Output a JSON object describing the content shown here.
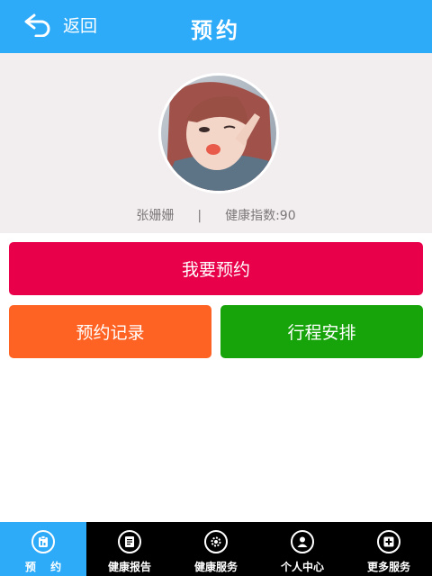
{
  "header": {
    "back_label": "返回",
    "title": "预约"
  },
  "profile": {
    "name": "张姗姗",
    "separator": "|",
    "health_index": "健康指数:90"
  },
  "actions": {
    "main": "我要预约",
    "record": "预约记录",
    "trip": "行程安排"
  },
  "tabbar": {
    "tabs": [
      {
        "label": "预 约",
        "icon": "clipboard-icon",
        "active": true
      },
      {
        "label": "健康报告",
        "icon": "report-icon",
        "active": false
      },
      {
        "label": "健康服务",
        "icon": "gear-icon",
        "active": false
      },
      {
        "label": "个人中心",
        "icon": "user-icon",
        "active": false
      },
      {
        "label": "更多服务",
        "icon": "plus-icon",
        "active": false
      }
    ]
  },
  "colors": {
    "header": "#2eabf8",
    "main_button": "#e8004a",
    "record_button": "#fe6324",
    "trip_button": "#17a40b",
    "tabbar": "#000000"
  }
}
